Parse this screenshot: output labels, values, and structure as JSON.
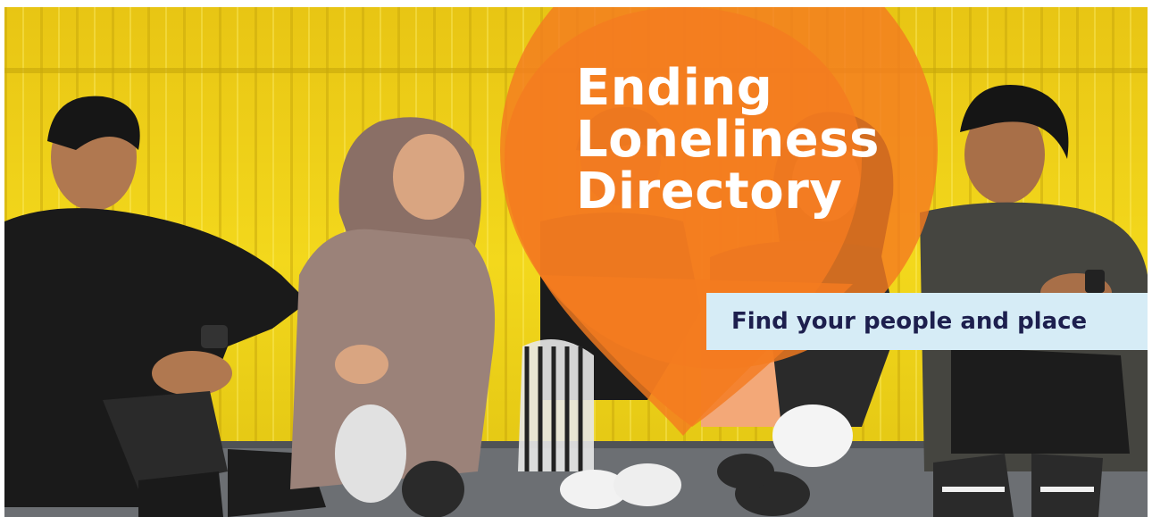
{
  "banner": {
    "title_lines": [
      "Ending",
      "Loneliness",
      "Directory"
    ],
    "tagline": "Find your people and place"
  },
  "colors": {
    "wall_yellow": "#f2d61a",
    "pin_orange": "#f47b20",
    "tagline_bg": "#d6ecf6",
    "tagline_text": "#1d1f4e",
    "title_text": "#ffffff"
  },
  "icons": [
    "location-pin-icon"
  ]
}
